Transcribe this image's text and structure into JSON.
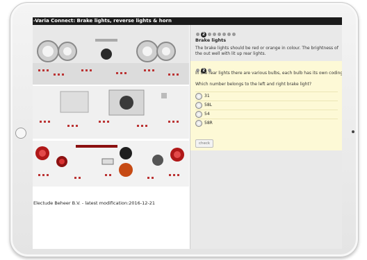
{
  "window": {
    "title": "-Varia Connect: Brake lights, reverse lights & horn"
  },
  "left": {
    "footer": "Electude Beheer B.V. - latest modification:2016-12-21"
  },
  "right": {
    "steps_top": {
      "active": "2",
      "count": 9
    },
    "info": {
      "title": "Brake lights",
      "text": "The brake lights should be red or orange in colour. The brightness of the out well with lit up rear lights."
    },
    "question": {
      "steps": {
        "active": "2",
        "count": 3
      },
      "text": "In the rear lights there are various bulbs, each bulb has its own coding/c",
      "ask": "Which number belongs to the left and right brake light?",
      "options": [
        "31",
        "58L",
        "54",
        "58R"
      ],
      "check_label": "check"
    }
  }
}
